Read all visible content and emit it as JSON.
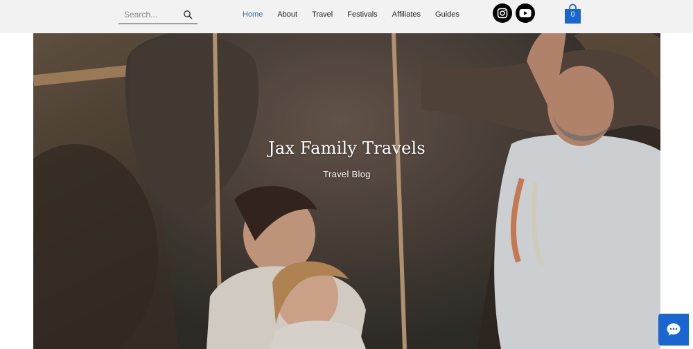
{
  "search": {
    "placeholder": "Search...",
    "value": ""
  },
  "nav": {
    "items": [
      {
        "label": "Home",
        "active": true
      },
      {
        "label": "About"
      },
      {
        "label": "Travel"
      },
      {
        "label": "Festivals"
      },
      {
        "label": "Affiliates"
      },
      {
        "label": "Guides"
      }
    ]
  },
  "social": {
    "icons": [
      "instagram-icon",
      "youtube-icon"
    ]
  },
  "cart": {
    "count": "0",
    "icon": "shopping-bag-icon",
    "color": "#1a66d1"
  },
  "hero": {
    "title": "Jax Family Travels",
    "subtitle": "Travel Blog"
  },
  "chat": {
    "icon": "chat-bubble-icon",
    "color": "#1a66d1"
  },
  "colors": {
    "accent": "#3b6aa6",
    "header_bg": "#f2f2f2",
    "brand_blue": "#1a66d1"
  }
}
